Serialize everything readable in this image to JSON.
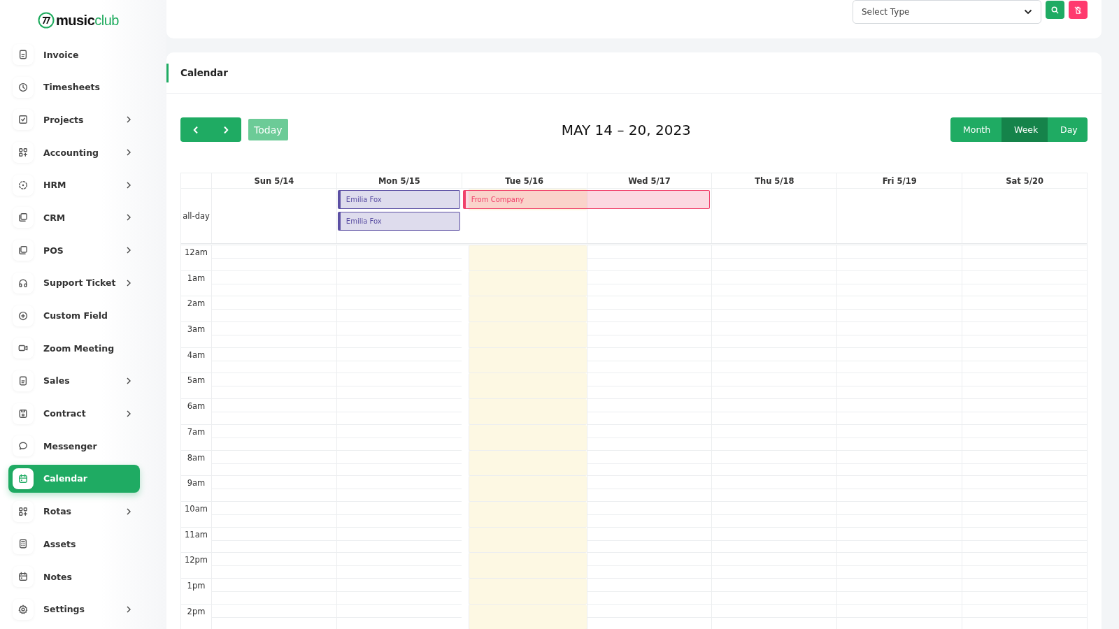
{
  "logo": {
    "part1": "music",
    "part2": "club"
  },
  "sidebar": {
    "items": [
      {
        "label": "Invoice",
        "expandable": false,
        "selected": false
      },
      {
        "label": "Timesheets",
        "expandable": false,
        "selected": false
      },
      {
        "label": "Projects",
        "expandable": true,
        "selected": false
      },
      {
        "label": "Accounting",
        "expandable": true,
        "selected": false
      },
      {
        "label": "HRM",
        "expandable": true,
        "selected": false
      },
      {
        "label": "CRM",
        "expandable": true,
        "selected": false
      },
      {
        "label": "POS",
        "expandable": true,
        "selected": false
      },
      {
        "label": "Support Ticket",
        "expandable": true,
        "selected": false
      },
      {
        "label": "Custom Field",
        "expandable": false,
        "selected": false
      },
      {
        "label": "Zoom Meeting",
        "expandable": false,
        "selected": false
      },
      {
        "label": "Sales",
        "expandable": true,
        "selected": false
      },
      {
        "label": "Contract",
        "expandable": true,
        "selected": false
      },
      {
        "label": "Messenger",
        "expandable": false,
        "selected": false
      },
      {
        "label": "Calendar",
        "expandable": false,
        "selected": true
      },
      {
        "label": "Rotas",
        "expandable": true,
        "selected": false
      },
      {
        "label": "Assets",
        "expandable": false,
        "selected": false
      },
      {
        "label": "Notes",
        "expandable": false,
        "selected": false
      },
      {
        "label": "Settings",
        "expandable": true,
        "selected": false
      }
    ]
  },
  "filter": {
    "placeholder": "Select Type"
  },
  "calendar": {
    "heading": "Calendar",
    "range_title": "MAY 14 – 20, 2023",
    "today_button": "Today",
    "today_disabled": true,
    "views": [
      {
        "label": "Month",
        "selected": false
      },
      {
        "label": "Week",
        "selected": true
      },
      {
        "label": "Day",
        "selected": false
      }
    ],
    "allday_label": "all-day",
    "days": [
      {
        "label": "Sun 5/14",
        "today": false
      },
      {
        "label": "Mon 5/15",
        "today": false,
        "events": [
          {
            "title": "Emilia Fox",
            "color": "#5b4fa3",
            "extends_to_next_day": false
          },
          {
            "title": "Emilia Fox",
            "color": "#5b4fa3",
            "extends_to_next_day": false
          }
        ]
      },
      {
        "label": "Tue 5/16",
        "today": true,
        "events": [
          {
            "title": "From Company",
            "color": "#f0406a",
            "extends_to_next_day": true
          }
        ]
      },
      {
        "label": "Wed 5/17",
        "today": false
      },
      {
        "label": "Thu 5/18",
        "today": false
      },
      {
        "label": "Fri 5/19",
        "today": false
      },
      {
        "label": "Sat 5/20",
        "today": false
      }
    ],
    "hours": [
      "12am",
      "1am",
      "2am",
      "3am",
      "4am",
      "5am",
      "6am",
      "7am",
      "8am",
      "9am",
      "10am",
      "11am",
      "12pm",
      "1pm",
      "2pm"
    ]
  }
}
